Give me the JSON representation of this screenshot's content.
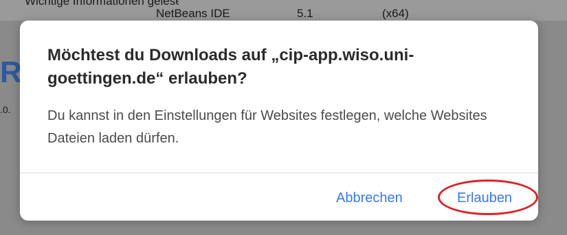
{
  "background": {
    "row": [
      "NetBeans IDE",
      "5.1",
      "(x64)"
    ],
    "partial_text": "Wichtige Informationen gelesen",
    "logo_letter": "R",
    "version_fragment": ".0."
  },
  "dialog": {
    "title": "Möchtest du Downloads auf „cip-app.wiso.uni-goettingen.de“ erlauben?",
    "message": "Du kannst in den Einstellungen für Websites festlegen, welche Websites Dateien laden dürfen.",
    "buttons": {
      "cancel": "Abbrechen",
      "allow": "Erlauben"
    }
  },
  "colors": {
    "accent": "#3478f6",
    "highlight": "#e01f26"
  }
}
